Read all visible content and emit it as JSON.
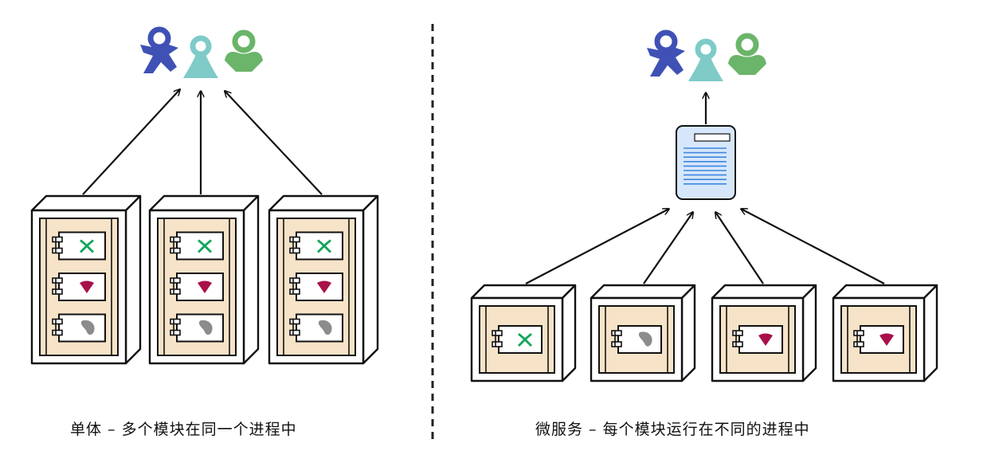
{
  "captions": {
    "left": "单体 – 多个模块在同一个进程中",
    "right": "微服务 – 每个模块运行在不同的进程中"
  },
  "colors": {
    "user_blue": "#3f51b5",
    "user_teal": "#7ecbc8",
    "user_green": "#6ab56a",
    "module_green": "#11a65a",
    "module_red": "#a8104a",
    "module_gray": "#8c8c8c",
    "cabinet_fill": "#f6e3c8",
    "gateway_fill": "#d7e7fb",
    "gateway_lines": "#3d86e0"
  },
  "icons": {
    "user": "person-icon",
    "module_a": "x-shape-icon",
    "module_b": "heart-shape-icon",
    "module_c": "blob-shape-icon",
    "gateway": "document-icon"
  },
  "monolith": {
    "servers": [
      {
        "modules": [
          "x-shape-icon",
          "heart-shape-icon",
          "blob-shape-icon"
        ]
      },
      {
        "modules": [
          "x-shape-icon",
          "heart-shape-icon",
          "blob-shape-icon"
        ]
      },
      {
        "modules": [
          "x-shape-icon",
          "heart-shape-icon",
          "blob-shape-icon"
        ]
      }
    ]
  },
  "microservices": {
    "servers": [
      {
        "modules": [
          "x-shape-icon"
        ]
      },
      {
        "modules": [
          "blob-shape-icon"
        ]
      },
      {
        "modules": [
          "heart-shape-icon"
        ]
      },
      {
        "modules": [
          "heart-shape-icon"
        ]
      }
    ]
  }
}
